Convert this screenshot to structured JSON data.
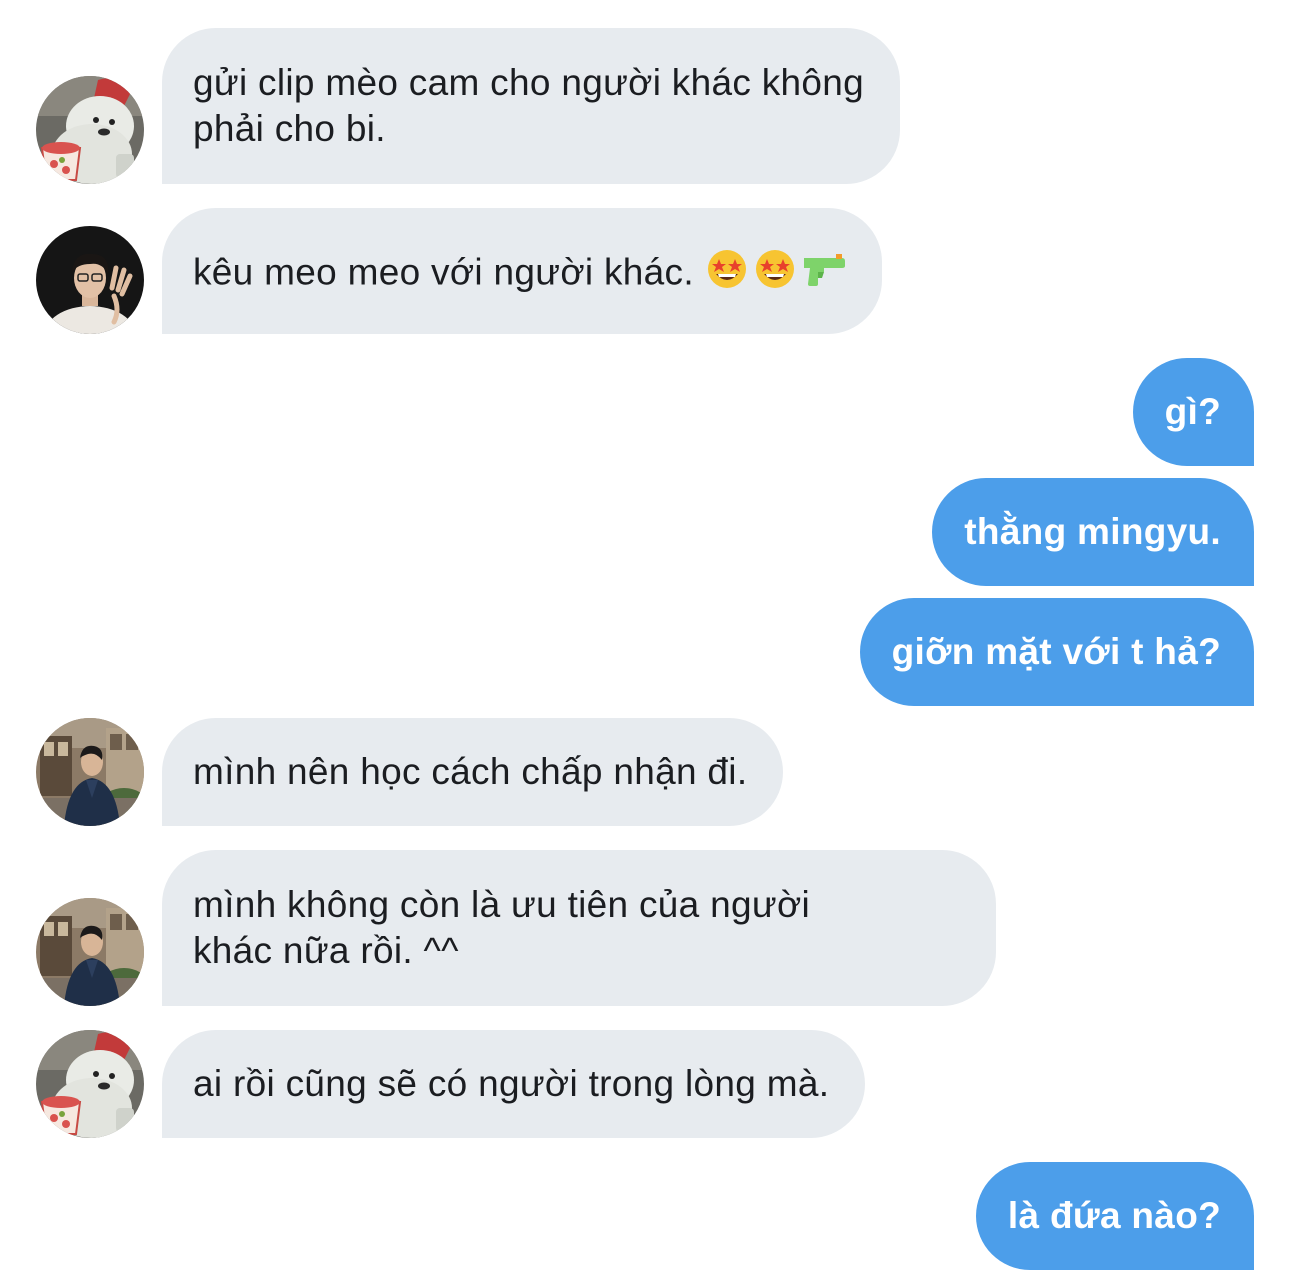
{
  "conversation": {
    "messages": [
      {
        "direction": "in",
        "avatar": "sticker-bear-icon",
        "lines": [
          "gửi clip mèo cam cho người khác không",
          "phải cho bi."
        ]
      },
      {
        "direction": "in",
        "avatar": "person-hand-photo",
        "lines": [
          "kêu meo meo với người khác."
        ],
        "emoji": [
          "star-struck-emoji",
          "star-struck-emoji",
          "water-pistol-emoji"
        ]
      },
      {
        "direction": "out",
        "lines": [
          "gì?"
        ]
      },
      {
        "direction": "out",
        "lines": [
          "thằng mingyu."
        ]
      },
      {
        "direction": "out",
        "lines": [
          "giỡn mặt với t hả?"
        ]
      },
      {
        "direction": "in",
        "avatar": "person-street-photo",
        "lines": [
          "mình nên học cách chấp nhận đi."
        ]
      },
      {
        "direction": "in",
        "avatar": "person-street-photo",
        "lines": [
          "mình không còn là ưu tiên của người",
          "khác nữa rồi. ^^"
        ]
      },
      {
        "direction": "in",
        "avatar": "sticker-bear-icon",
        "lines": [
          "ai rồi cũng sẽ có người trong lòng mà."
        ]
      },
      {
        "direction": "out",
        "lines": [
          "là đứa nào?"
        ]
      }
    ]
  },
  "colors": {
    "incoming_bubble": "#e7ebef",
    "outgoing_bubble": "#4c9eea",
    "incoming_text": "#1b1d21",
    "outgoing_text": "#ffffff"
  }
}
